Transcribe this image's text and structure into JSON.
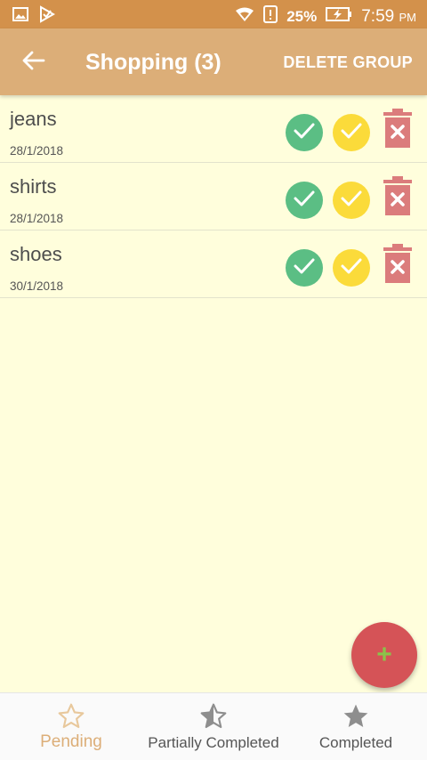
{
  "status_bar": {
    "battery_percent": "25%",
    "time": "7:59",
    "ampm": "PM",
    "icons": [
      "image-icon",
      "check-app-icon",
      "wifi-icon",
      "alert-icon",
      "battery-icon"
    ]
  },
  "app_bar": {
    "title": "Shopping (3)",
    "delete_label": "DELETE GROUP",
    "back_icon": "arrow-back-icon"
  },
  "items": [
    {
      "name": "jeans",
      "date": "28/1/2018"
    },
    {
      "name": "shirts",
      "date": "28/1/2018"
    },
    {
      "name": "shoes",
      "date": "30/1/2018"
    }
  ],
  "fab": {
    "label": "+"
  },
  "bottom_nav": {
    "items": [
      {
        "label": "Pending",
        "icon": "star-outline-icon",
        "active": true
      },
      {
        "label": "Partially Completed",
        "icon": "star-half-icon",
        "active": false
      },
      {
        "label": "Completed",
        "icon": "star-filled-icon",
        "active": false
      }
    ]
  },
  "colors": {
    "status_bar": "#D3914B",
    "app_bar": "#DCAE78",
    "background": "#FFFEDC",
    "complete_green": "#5BBE84",
    "partial_yellow": "#FBDB3A",
    "delete_red": "#DB7C7C",
    "fab": "#D55357"
  }
}
